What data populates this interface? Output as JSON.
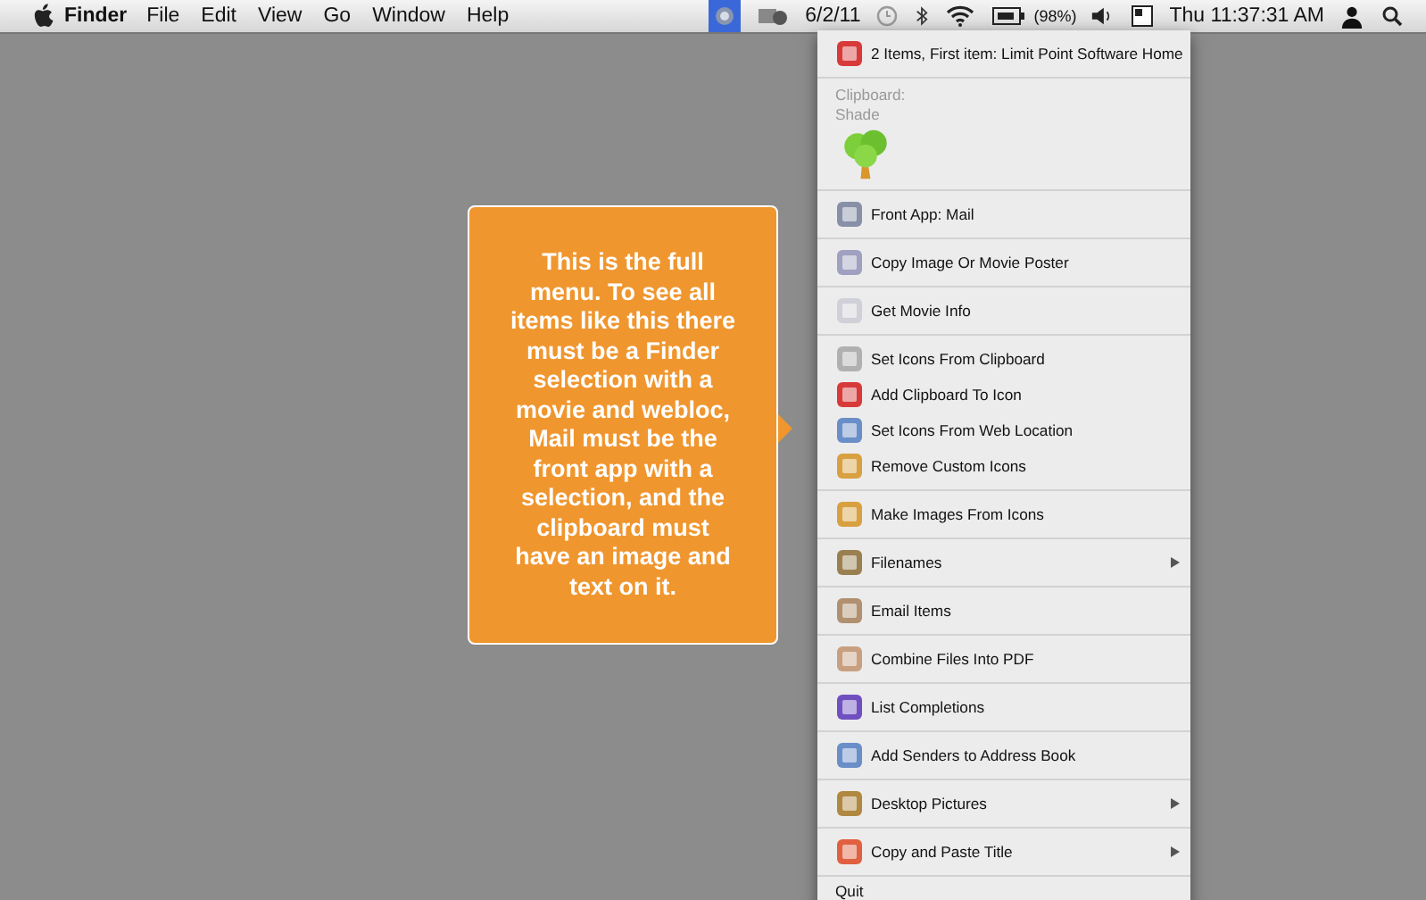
{
  "menubar": {
    "app_name": "Finder",
    "menus": [
      "File",
      "Edit",
      "View",
      "Go",
      "Window",
      "Help"
    ],
    "status_app_selected": true,
    "date": "6/2/11",
    "battery": "(98%)",
    "clock": "Thu 11:37:31 AM"
  },
  "callout": {
    "text": "This is the full menu. To see all items like this there must be a Finder selection with a movie and webloc, Mail must be the front app with a selection, and the clipboard must have an image and text on it."
  },
  "menu": {
    "sections": [
      [
        {
          "kind": "item",
          "label": "2 Items, First item: Limit Point Software Home",
          "submenu": false
        }
      ],
      [
        {
          "kind": "clipboard",
          "label": "Clipboard:",
          "value": "Shade"
        }
      ],
      [
        {
          "kind": "item",
          "label": "Front App: Mail",
          "submenu": false
        }
      ],
      [
        {
          "kind": "item",
          "label": "Copy Image Or Movie Poster",
          "submenu": false
        }
      ],
      [
        {
          "kind": "item",
          "label": "Get Movie Info",
          "submenu": false
        }
      ],
      [
        {
          "kind": "item",
          "label": "Set Icons From Clipboard",
          "submenu": false
        },
        {
          "kind": "item",
          "label": "Add Clipboard To Icon",
          "submenu": false
        },
        {
          "kind": "item",
          "label": "Set Icons From Web Location",
          "submenu": false
        },
        {
          "kind": "item",
          "label": "Remove Custom Icons",
          "submenu": false
        }
      ],
      [
        {
          "kind": "item",
          "label": "Make Images From Icons",
          "submenu": false
        }
      ],
      [
        {
          "kind": "item",
          "label": "Filenames",
          "submenu": true
        }
      ],
      [
        {
          "kind": "item",
          "label": "Email Items",
          "submenu": false
        }
      ],
      [
        {
          "kind": "item",
          "label": "Combine Files Into PDF",
          "submenu": false
        }
      ],
      [
        {
          "kind": "item",
          "label": "List Completions",
          "submenu": false
        }
      ],
      [
        {
          "kind": "item",
          "label": "Add Senders to Address Book",
          "submenu": false
        }
      ],
      [
        {
          "kind": "item",
          "label": "Desktop Pictures",
          "submenu": true
        }
      ],
      [
        {
          "kind": "item",
          "label": "Copy and Paste Title",
          "submenu": true
        }
      ],
      [
        {
          "kind": "plain",
          "label": "Quit"
        }
      ]
    ]
  }
}
